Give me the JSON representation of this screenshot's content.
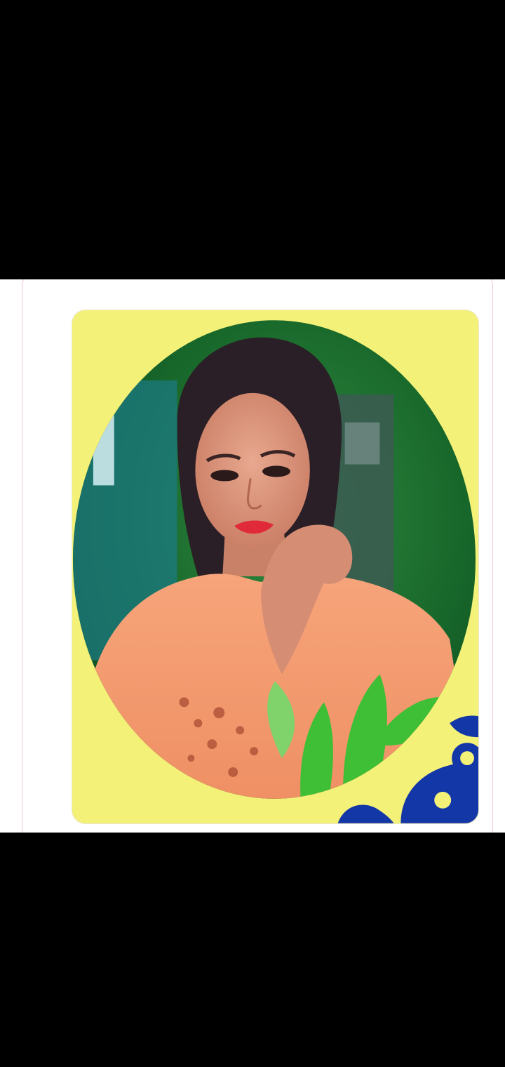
{
  "viewer": {
    "background": "#000000",
    "content_background": "#ffffff",
    "card_border": "#f2c9d2"
  },
  "photo": {
    "frame_color": "#f4f178",
    "backdrop_color": "#1a6e2c",
    "outfit_color": "#f49c6f",
    "pattern_color": "#1437a8",
    "plant_color": "#3fbf35"
  }
}
